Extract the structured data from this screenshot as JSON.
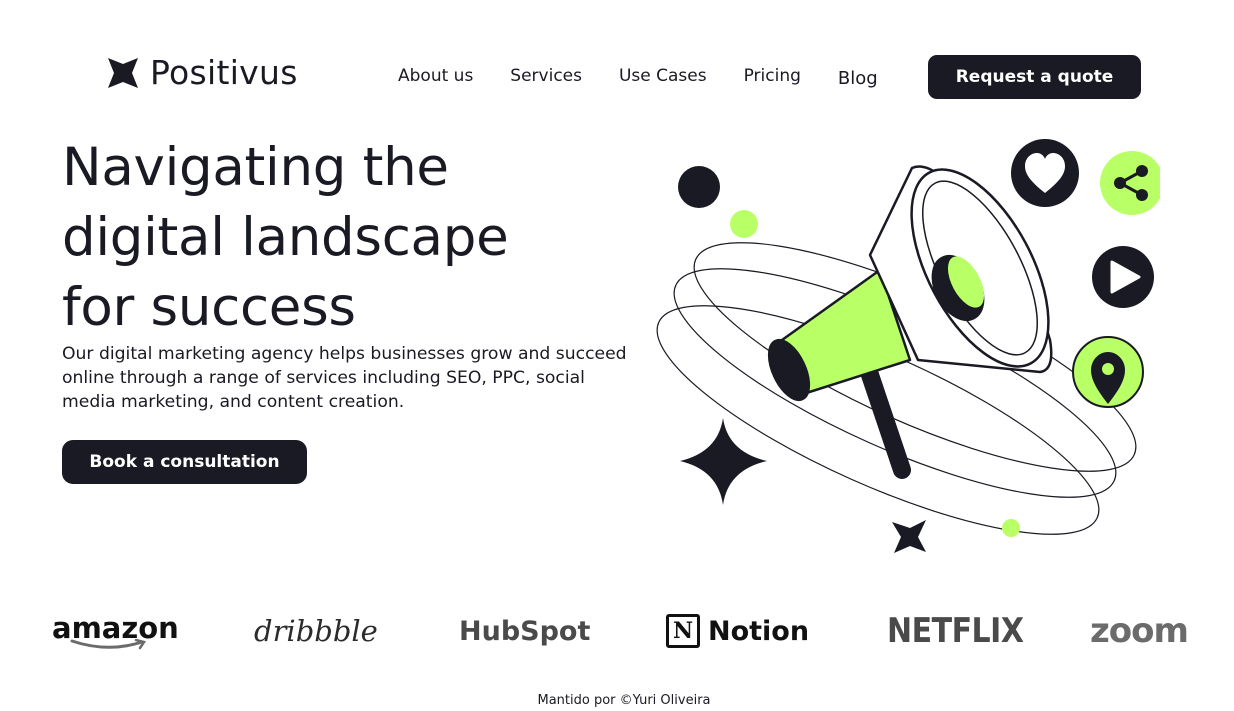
{
  "header": {
    "logo_text": "Positivus",
    "logo_icon": "positivus-logo-icon",
    "nav": [
      "About us",
      "Services",
      "Use Cases",
      "Pricing",
      "Blog"
    ],
    "cta_label": "Request a quote"
  },
  "hero": {
    "title_lines": [
      "Navigating the",
      "digital landscape",
      "for success"
    ],
    "description": "Our digital marketing agency helps businesses grow and succeed online through a range of services including SEO, PPC, social media marketing, and content creation.",
    "button_label": "Book a consultation",
    "illustration_icons": [
      "megaphone-icon",
      "heart-icon",
      "share-icon",
      "play-icon",
      "location-pin-icon",
      "sparkle-star-icon"
    ]
  },
  "brands": [
    "amazon",
    "dribbble",
    "HubSpot",
    "Notion",
    "NETFLIX",
    "zoom"
  ],
  "footer": {
    "credit": "Mantido por ©Yuri Oliveira"
  },
  "colors": {
    "dark": "#191A23",
    "accent": "#B9FF66",
    "white": "#FFFFFF"
  }
}
